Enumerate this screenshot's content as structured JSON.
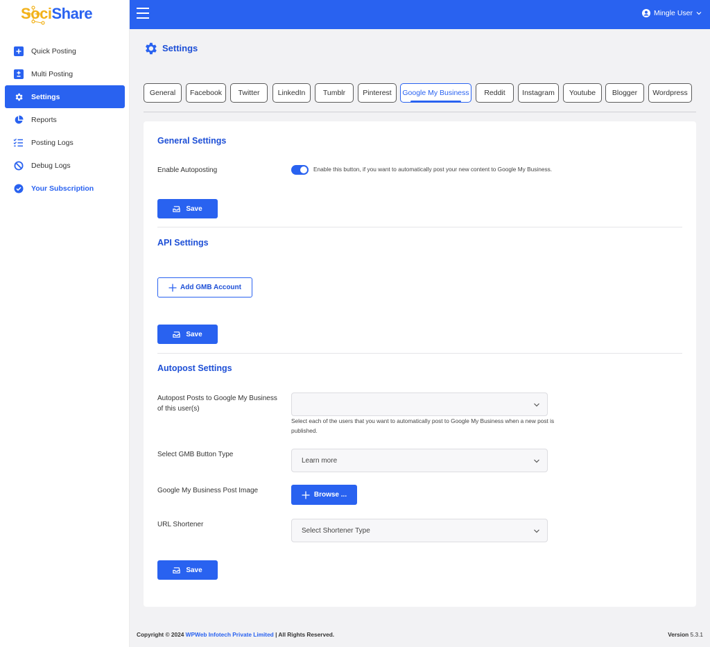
{
  "brand": {
    "part1": "S",
    "part2": "o",
    "part3": "ci",
    "part4": "Share"
  },
  "sidebar": {
    "items": [
      {
        "label": "Quick Posting",
        "icon": "plus-square-icon"
      },
      {
        "label": "Multi Posting",
        "icon": "plus-minus-square-icon"
      },
      {
        "label": "Settings",
        "icon": "gear-icon",
        "active": true
      },
      {
        "label": "Reports",
        "icon": "pie-chart-icon"
      },
      {
        "label": "Posting Logs",
        "icon": "checklist-icon"
      },
      {
        "label": "Debug Logs",
        "icon": "debug-icon"
      },
      {
        "label": "Your Subscription",
        "icon": "badge-check-icon"
      }
    ]
  },
  "topbar": {
    "user": "Mingle User"
  },
  "page": {
    "title": "Settings"
  },
  "tabs": [
    "General",
    "Facebook",
    "Twitter",
    "LinkedIn",
    "Tumblr",
    "Pinterest",
    "Google My Business",
    "Reddit",
    "Instagram",
    "Youtube",
    "Blogger",
    "Wordpress"
  ],
  "active_tab": "Google My Business",
  "general": {
    "title": "General Settings",
    "autopost_label": "Enable Autoposting",
    "autopost_enabled": true,
    "autopost_desc": "Enable this button, if you want to automatically post your new content to Google My Business.",
    "save": "Save"
  },
  "api": {
    "title": "API Settings",
    "add_account": "Add GMB Account",
    "save": "Save"
  },
  "autopost": {
    "title": "Autopost Settings",
    "users_label": "Autopost Posts to Google My Business of this user(s)",
    "users_value": "",
    "users_help": "Select each of the users that you want to automatically post to Google My Business when a new post is published.",
    "button_type_label": "Select GMB Button Type",
    "button_type_value": "Learn more",
    "image_label": "Google My Business Post Image",
    "browse": "Browse ...",
    "shortener_label": "URL Shortener",
    "shortener_value": "Select Shortener Type",
    "save": "Save"
  },
  "footer": {
    "copyright_prefix": "Copyright © 2024",
    "company": "WPWeb Infotech Private Limited",
    "suffix": "| All Rights Reserved.",
    "version_label": "Version",
    "version": "5.3.1"
  },
  "colors": {
    "primary": "#2962f0",
    "accent": "#f2b21b",
    "title": "#1d4fd6"
  }
}
